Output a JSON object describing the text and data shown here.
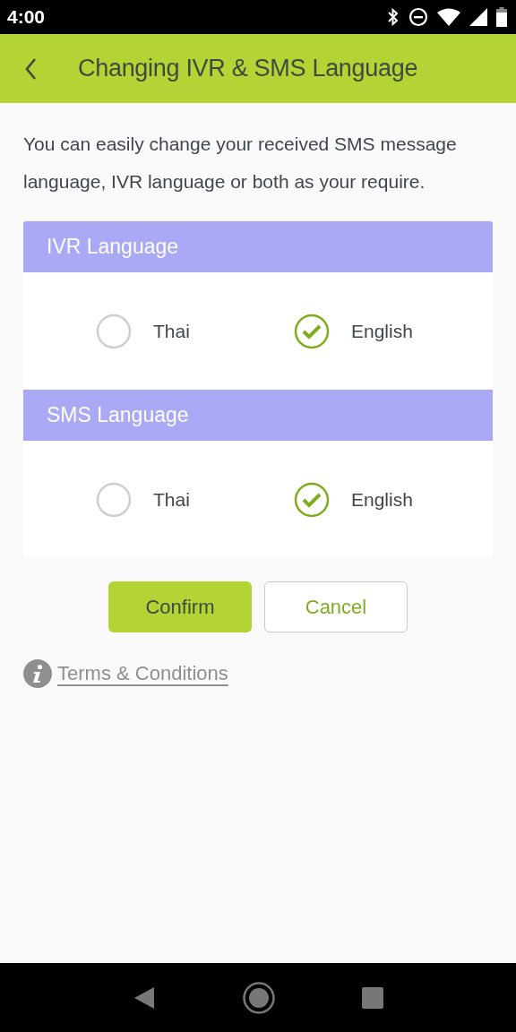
{
  "status_bar": {
    "time": "4:00"
  },
  "header": {
    "title": "Changing IVR & SMS Language"
  },
  "intro": "You can easily change your received SMS message language, IVR language or both as your require.",
  "sections": [
    {
      "title": "IVR Language",
      "options": [
        {
          "label": "Thai",
          "selected": false
        },
        {
          "label": "English",
          "selected": true
        }
      ]
    },
    {
      "title": "SMS Language",
      "options": [
        {
          "label": "Thai",
          "selected": false
        },
        {
          "label": "English",
          "selected": true
        }
      ]
    }
  ],
  "buttons": [
    {
      "label": "Confirm",
      "kind": "primary"
    },
    {
      "label": "Cancel",
      "kind": "secondary"
    }
  ],
  "terms_link": "Terms & Conditions"
}
